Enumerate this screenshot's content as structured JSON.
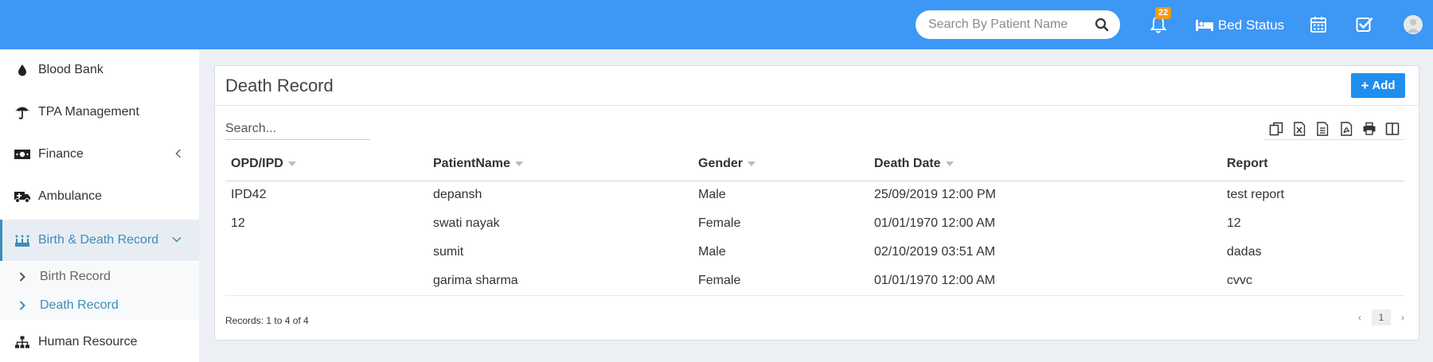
{
  "header": {
    "search_placeholder": "Search By Patient Name",
    "notification_count": "22",
    "bed_status_label": "Bed Status"
  },
  "sidebar": {
    "items": [
      {
        "label": "Blood Bank",
        "icon": "drop-icon"
      },
      {
        "label": "TPA Management",
        "icon": "umbrella-icon"
      },
      {
        "label": "Finance",
        "icon": "money-icon"
      },
      {
        "label": "Ambulance",
        "icon": "ambulance-icon"
      },
      {
        "label": "Birth & Death Record",
        "icon": "birthday-cake-icon"
      },
      {
        "label": "Human Resource",
        "icon": "sitemap-icon"
      }
    ],
    "submenu": [
      {
        "label": "Birth Record"
      },
      {
        "label": "Death Record"
      }
    ]
  },
  "main": {
    "title": "Death Record",
    "add_label": "Add",
    "search_placeholder": "Search...",
    "columns": [
      "OPD/IPD",
      "PatientName",
      "Gender",
      "Death Date",
      "Report"
    ],
    "rows": [
      [
        "IPD42",
        "depansh",
        "Male",
        "25/09/2019 12:00 PM",
        "test report"
      ],
      [
        "12",
        "swati nayak",
        "Female",
        "01/01/1970 12:00 AM",
        "12"
      ],
      [
        "",
        "sumit",
        "Male",
        "02/10/2019 03:51 AM",
        "dadas"
      ],
      [
        "",
        "garima sharma",
        "Female",
        "01/01/1970 12:00 AM",
        "cvvc"
      ]
    ],
    "records_info": "Records: 1 to 4 of 4",
    "pagination": {
      "current_page": "1",
      "prev": "‹",
      "next": "›"
    }
  },
  "colors": {
    "topbar": "#3c97f5",
    "accent": "#3c8dbc",
    "add_button": "#1f8eed",
    "badge": "#f39c12"
  }
}
